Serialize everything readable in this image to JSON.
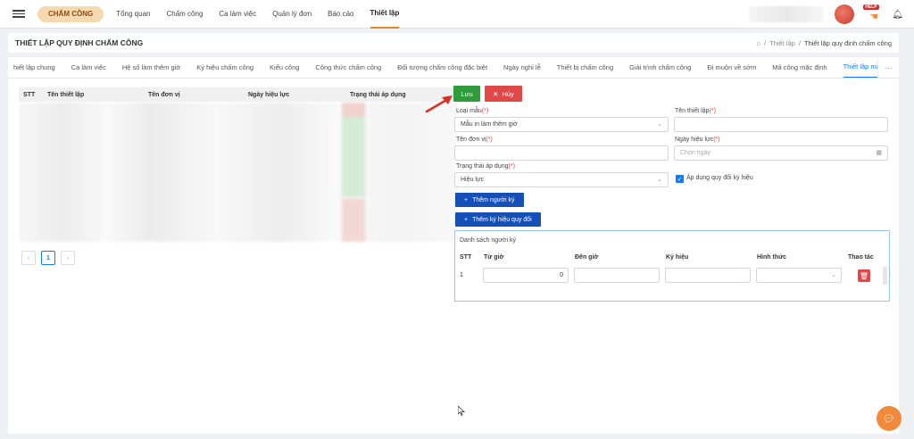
{
  "topbar": {
    "module_label": "CHẤM CÔNG",
    "nav": [
      {
        "label": "Tổng quan"
      },
      {
        "label": "Chấm công"
      },
      {
        "label": "Ca làm việc"
      },
      {
        "label": "Quản lý đơn"
      },
      {
        "label": "Báo cáo"
      },
      {
        "label": "Thiết lập",
        "active": true
      }
    ],
    "badge": "HELP"
  },
  "page": {
    "title": "THIẾT LẬP QUY ĐỊNH CHẤM CÔNG",
    "breadcrumb": [
      "Thiết lập",
      "Thiết lập quy định chấm công"
    ]
  },
  "tabs": [
    {
      "label": "hiết lập chung"
    },
    {
      "label": "Ca làm việc"
    },
    {
      "label": "Hệ số làm thêm giờ"
    },
    {
      "label": "Ký hiệu chấm công"
    },
    {
      "label": "Kiểu công"
    },
    {
      "label": "Công thức chấm công"
    },
    {
      "label": "Đối tượng chấm công đặc biệt"
    },
    {
      "label": "Ngày nghỉ lễ"
    },
    {
      "label": "Thiết bị chấm công"
    },
    {
      "label": "Giải trình chấm công"
    },
    {
      "label": "Đi muộn về sớm"
    },
    {
      "label": "Mã công mặc định"
    },
    {
      "label": "Thiết lập mẫu in",
      "active": true
    }
  ],
  "list_table": {
    "columns": [
      "STT",
      "Tên thiết lập",
      "Tên đơn vị",
      "Ngày hiệu lực",
      "Trạng thái áp dụng"
    ],
    "pagination": {
      "prev": "‹",
      "current": "1",
      "next": "›"
    }
  },
  "actions": {
    "save_label": "Lưu",
    "cancel_label": "Hủy"
  },
  "form": {
    "template_type": {
      "label": "Loại mẫu",
      "required": "(*)",
      "value": "Mẫu in làm thêm giờ"
    },
    "setting_name": {
      "label": "Tên thiết lập",
      "required": "(*)",
      "value": ""
    },
    "unit_name": {
      "label": "Tên đơn vị",
      "required": "(*)",
      "value": ""
    },
    "effective_date": {
      "label": "Ngày hiệu lực",
      "required": "(*)",
      "placeholder": "Chọn ngày"
    },
    "status": {
      "label": "Trạng thái áp dụng",
      "required": "(*)",
      "value": "Hiệu lực"
    },
    "apply_symbol_conversion": {
      "label": "Áp dụng quy đổi ký hiệu",
      "checked": true
    },
    "add_signer_label": "Thêm người ký",
    "add_conversion_label": "Thêm ký hiệu quy đổi"
  },
  "signers": {
    "title": "Danh sách người ký",
    "columns": [
      "STT",
      "Từ giờ",
      "Đến giờ",
      "Ký hiệu",
      "Hình thức",
      "Thao tác"
    ],
    "rows": [
      {
        "stt": "1",
        "from": "0",
        "to": "",
        "symbol": "",
        "type": ""
      }
    ]
  }
}
